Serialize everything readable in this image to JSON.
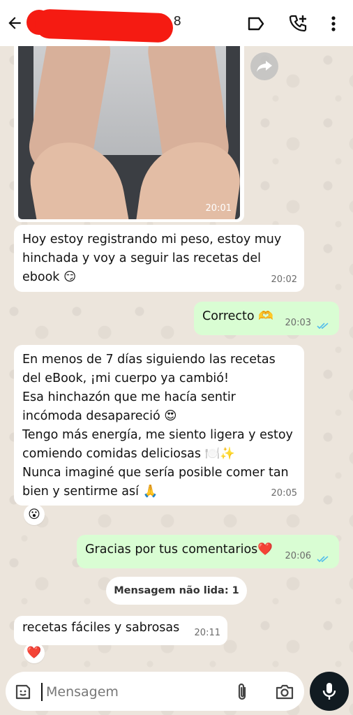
{
  "header": {
    "contact_name": "8",
    "icons": [
      "back-arrow-icon",
      "label-icon",
      "add-call-icon",
      "more-vertical-icon"
    ]
  },
  "messages": [
    {
      "type": "image",
      "direction": "incoming",
      "time": "20:01"
    },
    {
      "type": "text",
      "direction": "incoming",
      "text": "Hoy estoy registrando mi peso, estoy muy hinchada y voy a seguir las recetas del ebook 😏",
      "time": "20:02"
    },
    {
      "type": "text",
      "direction": "outgoing",
      "text": "Correcto 🫶",
      "time": "20:03",
      "status": "read"
    },
    {
      "type": "text",
      "direction": "incoming",
      "lines": [
        "En menos de 7 días siguiendo las recetas del eBook, ¡mi cuerpo ya cambió!",
        "Esa hinchazón que me hacía sentir incómoda desapareció 😍",
        "Tengo más energía, me siento ligera y estoy comiendo comidas deliciosas 🍽️✨",
        "Nunca imaginé que sería posible comer tan bien y sentirme así 🙏"
      ],
      "time": "20:05",
      "reaction": "😮"
    },
    {
      "type": "text",
      "direction": "outgoing",
      "text": "Gracias por tus comentarios❤️",
      "time": "20:06",
      "status": "read"
    },
    {
      "type": "text",
      "direction": "incoming",
      "text": "recetas fáciles y sabrosas",
      "time": "20:11",
      "reaction": "❤️"
    }
  ],
  "unread_banner": "Mensagem não lida: 1",
  "composer": {
    "placeholder": "Mensagem"
  },
  "colors": {
    "outgoing": "#d9fdd3",
    "incoming": "#ffffff",
    "read_ticks": "#53bdeb",
    "mic_button": "#111b21"
  }
}
